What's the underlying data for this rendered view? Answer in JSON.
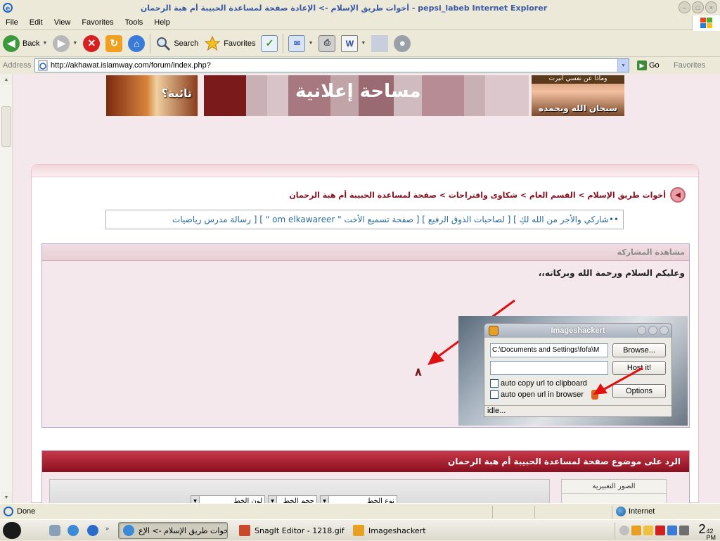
{
  "window": {
    "title": "أخوات طريق الإسلام -> الإعادة صفحة لمساعدة الحبيبة أم هبة الرحمان - pepsi_labeb Internet Explorer"
  },
  "menu": [
    "File",
    "Edit",
    "View",
    "Favorites",
    "Tools",
    "Help"
  ],
  "toolbar": {
    "back_label": "Back",
    "search_label": "Search",
    "favorites_label": "Favorites"
  },
  "address": {
    "label": "Address",
    "url": "http://akhawat.islamway.com/forum/index.php?",
    "go_label": "Go",
    "favorites_link": "Favorites"
  },
  "banners": {
    "left_text": "تائبة؟",
    "mid_text": "مساحة إعلانية",
    "right_top": "وماذا عن نفسي أنيرت",
    "right_text": "سبحان الله وبحمده"
  },
  "breadcrumb": "أخوات طريق الإسلام > القسم العام > شكاوى واقتراحات > صفحة لمساعدة الحبيبة أم هبة الرحمان",
  "marquee": "••شاركي والأجر من الله لكِ ]  [ لصاحبات الذوق الرفيع ]  [ صفحة تسميع الأخت \" om elkawareer \" ]  [ رسالة مدرس رياضيات",
  "post": {
    "header": "مشاهدة المشاركة",
    "greeting": "وعليكم السلام ورحمة الله وبركاته،،",
    "number": "٨"
  },
  "imageshack": {
    "title": "Imageshackert",
    "path_value": "C:\\Documents and Settings\\fofa\\M",
    "browse_label": "Browse...",
    "host_label": "Host it!",
    "options_label": "Options",
    "chk_copy": "auto copy url to clipboard",
    "chk_open": "auto open url in browser",
    "status": "idle..."
  },
  "reply": {
    "header": "الرد على موضوع صفحة لمساعدة الحبيبة أم هبة الرحمان",
    "emoji_header": "الصور التعبيرية",
    "font_type": "نوع الخط",
    "font_size": "حجم الخط",
    "font_color": "لون الخط"
  },
  "status": {
    "text": "Done",
    "zone": "Internet"
  },
  "taskbar": {
    "tasks": [
      "أخوات طريق الإسلام -> الإع...",
      "SnagIt Editor - 1218.gif",
      "Imageshackert"
    ],
    "time_hour": "2",
    "time_min": "42",
    "time_ampm": "PM"
  },
  "colors": {
    "accent_maroon": "#8a1020",
    "page_pink": "#f5e8ec",
    "arrow_red": "#e01010"
  }
}
